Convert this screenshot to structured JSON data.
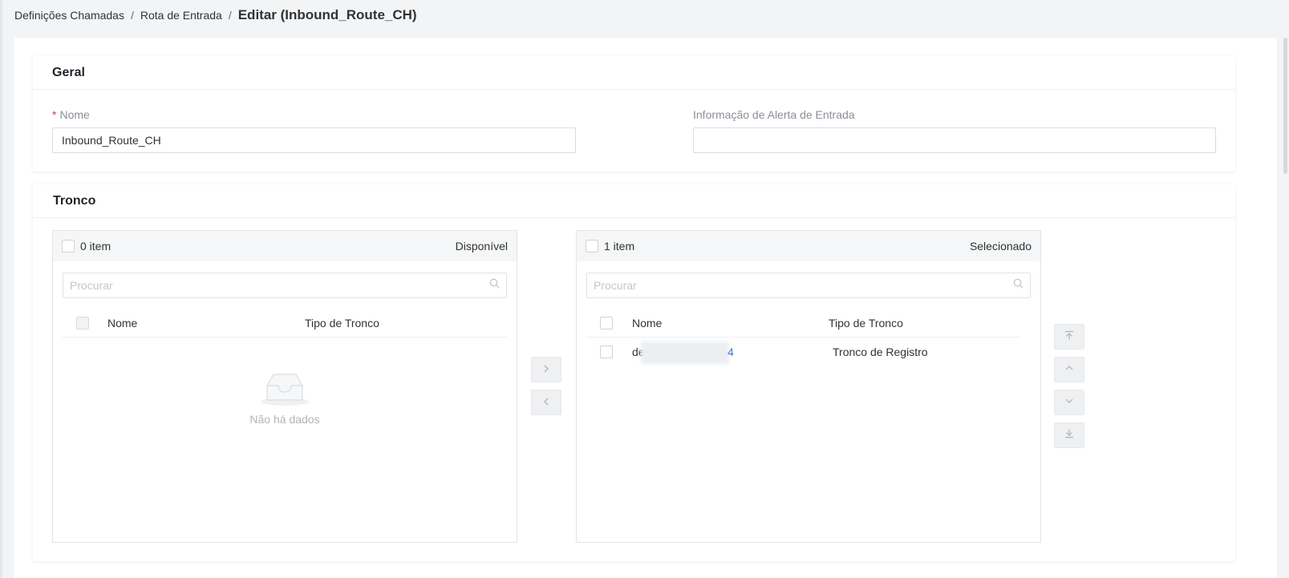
{
  "breadcrumb": {
    "item1": "Definições Chamadas",
    "sep1": "/",
    "item2": "Rota de Entrada",
    "sep2": "/",
    "current": "Editar (Inbound_Route_CH)"
  },
  "general": {
    "title": "Geral",
    "name_required_mark": "*",
    "name_label": "Nome",
    "name_value": "Inbound_Route_CH",
    "alert_label": "Informação de Alerta de Entrada",
    "alert_value": ""
  },
  "trunk": {
    "title": "Tronco",
    "available": {
      "count": "0 item",
      "title": "Disponível",
      "search_placeholder": "Procurar",
      "col_name": "Nome",
      "col_type": "Tipo de Tronco",
      "empty_text": "Não há dados"
    },
    "selected": {
      "count": "1 item",
      "title": "Selecionado",
      "search_placeholder": "Procurar",
      "col_name": "Nome",
      "col_type": "Tipo de Tronco",
      "rows": [
        {
          "name_visible_start": "de",
          "name_visible_end": "4",
          "type": "Tronco de Registro"
        }
      ]
    },
    "transfer_icons": {
      "right": "chevron-right-icon",
      "left": "chevron-left-icon"
    },
    "order_icons": [
      "move-top-icon",
      "move-up-icon",
      "move-down-icon",
      "move-bottom-icon"
    ]
  },
  "colors": {
    "required": "#e6393f",
    "panel_head": "#f5f6f7",
    "button_bg": "#eef0f2"
  }
}
